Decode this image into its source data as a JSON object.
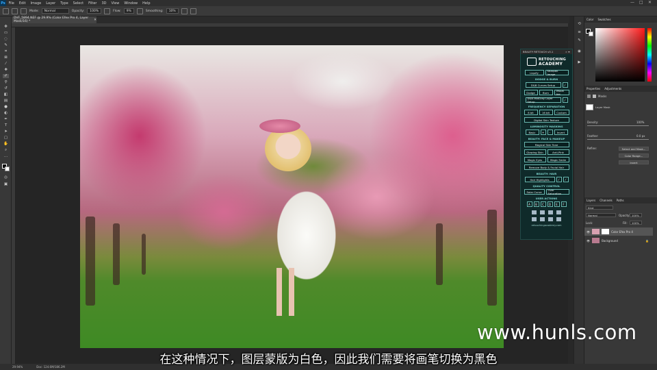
{
  "menubar": {
    "logo": "Ps",
    "items": [
      "File",
      "Edit",
      "Image",
      "Layer",
      "Type",
      "Select",
      "Filter",
      "3D",
      "View",
      "Window",
      "Help"
    ],
    "window_controls": [
      "—",
      "□",
      "✕"
    ]
  },
  "options_bar": {
    "mode_label": "Mode:",
    "mode_value": "Normal",
    "opacity_label": "Opacity:",
    "opacity_value": "100%",
    "flow_label": "Flow:",
    "flow_value": "9%",
    "smoothing_label": "Smoothing:",
    "smoothing_value": "10%"
  },
  "document": {
    "tab_title": "DVF_5894.NEF @ 29.9% (Color Efex Pro 4, Layer Mask/16) *",
    "tab_close": "✕"
  },
  "retouch_panel": {
    "header": "BEAUTY RETOUCH v3.1",
    "header_ctrl": "» ≡",
    "logo_line1": "RETOUCHING",
    "logo_line2": "ACADEMY",
    "top_buttons": [
      "Liquify",
      "Sharpen Image"
    ],
    "dodge_burn_title": "DODGE & BURN",
    "db_row1": "D&B Curves Setup",
    "db_row2": [
      "Dodge",
      "Burn",
      "Visual Aid"
    ],
    "db_row3": "D&B MidGray Layer Setup",
    "freq_title": "FREQUENCY SEPARATION",
    "freq_buttons": [
      "8 bit",
      "16 bit",
      "Custom"
    ],
    "freq_texture": "Digital Skin Texture",
    "lum_title": "LUMINOSITY MASKING",
    "lum_buttons": [
      "Basic",
      "+",
      "-",
      "Invert"
    ],
    "face_title": "BEAUTY: FACE & MAKEUP",
    "face_magical": "Magical Skin Tone",
    "face_row1": [
      "Glowing Skin",
      "Anti-Pink"
    ],
    "face_row2": [
      "Magic Eyes",
      "Magic Smile"
    ],
    "face_remove": "Remove Body & Facial Hair",
    "hair_title": "BEAUTY: HAIR",
    "hair_button": "Hair Highlights",
    "quality_title": "QUALITY CONTROL",
    "quality_buttons": [
      "Solar Curve",
      "Over Saturation"
    ],
    "actions_title": "USER ACTIONS",
    "actions": [
      "A",
      "B",
      "C",
      "D",
      "E",
      "F"
    ],
    "url": "retouchingacademy.com"
  },
  "right_panel": {
    "color_tabs": [
      "Color",
      "Swatches"
    ],
    "properties_tabs": [
      "Properties",
      "Adjustments"
    ],
    "masks_label": "Masks",
    "layer_mask_label": "Layer Mask",
    "density_label": "Density:",
    "density_value": "100%",
    "feather_label": "Feather:",
    "feather_value": "0.0 px",
    "refine_label": "Refine:",
    "refine_buttons": [
      "Select and Mask...",
      "Color Range...",
      "Invert"
    ],
    "layers_tabs": [
      "Layers",
      "Channels",
      "Paths"
    ],
    "kind_label": "Kind",
    "blend_mode": "Normal",
    "opacity_label": "Opacity:",
    "opacity_value": "100%",
    "lock_label": "Lock:",
    "fill_label": "Fill:",
    "fill_value": "100%",
    "layers": [
      {
        "name": "Color Efex Pro 4"
      },
      {
        "name": "Background"
      }
    ]
  },
  "statusbar": {
    "zoom": "29.94%",
    "doc": "Doc: 124.6M/186.2M"
  },
  "subtitle": "在这种情况下，图层蒙版为白色，因此我们需要将画笔切换为黑色",
  "watermark": "www.hunls.com"
}
